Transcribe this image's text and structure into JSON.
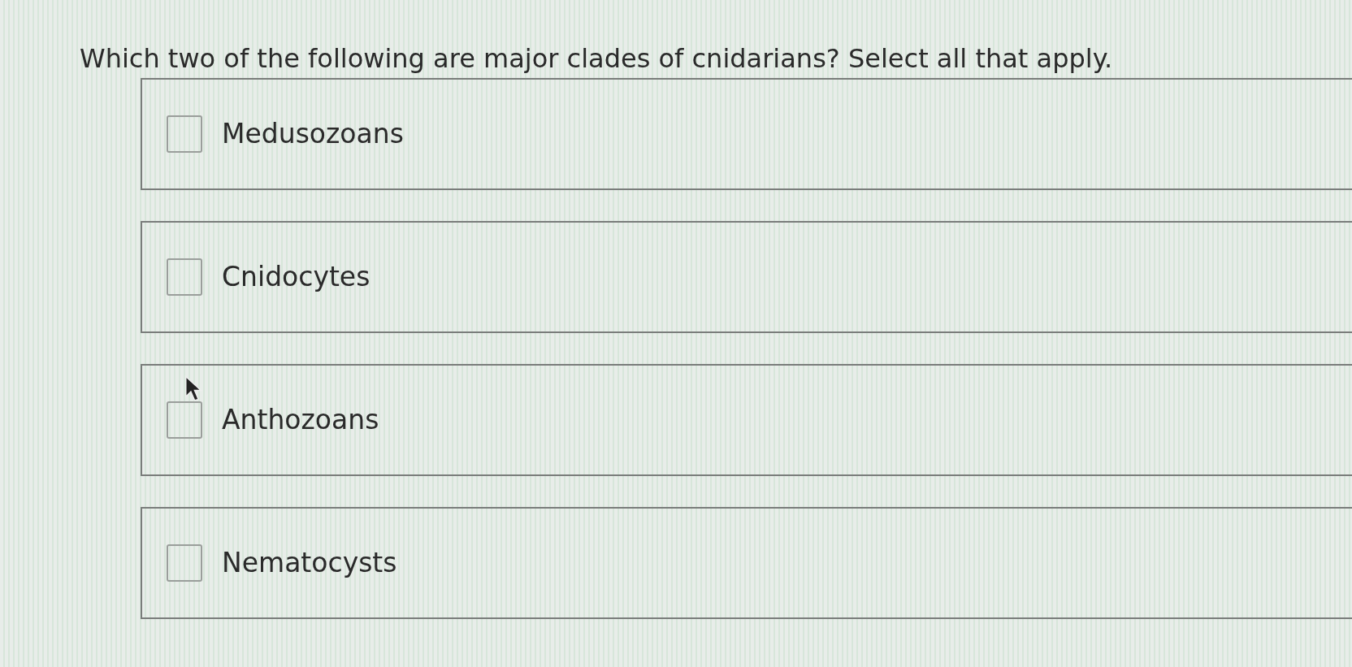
{
  "question": "Which two of the following are major clades of cnidarians? Select all that apply.",
  "options": [
    {
      "label": "Medusozoans",
      "checked": false
    },
    {
      "label": "Cnidocytes",
      "checked": false
    },
    {
      "label": "Anthozoans",
      "checked": false
    },
    {
      "label": "Nematocysts",
      "checked": false
    }
  ]
}
